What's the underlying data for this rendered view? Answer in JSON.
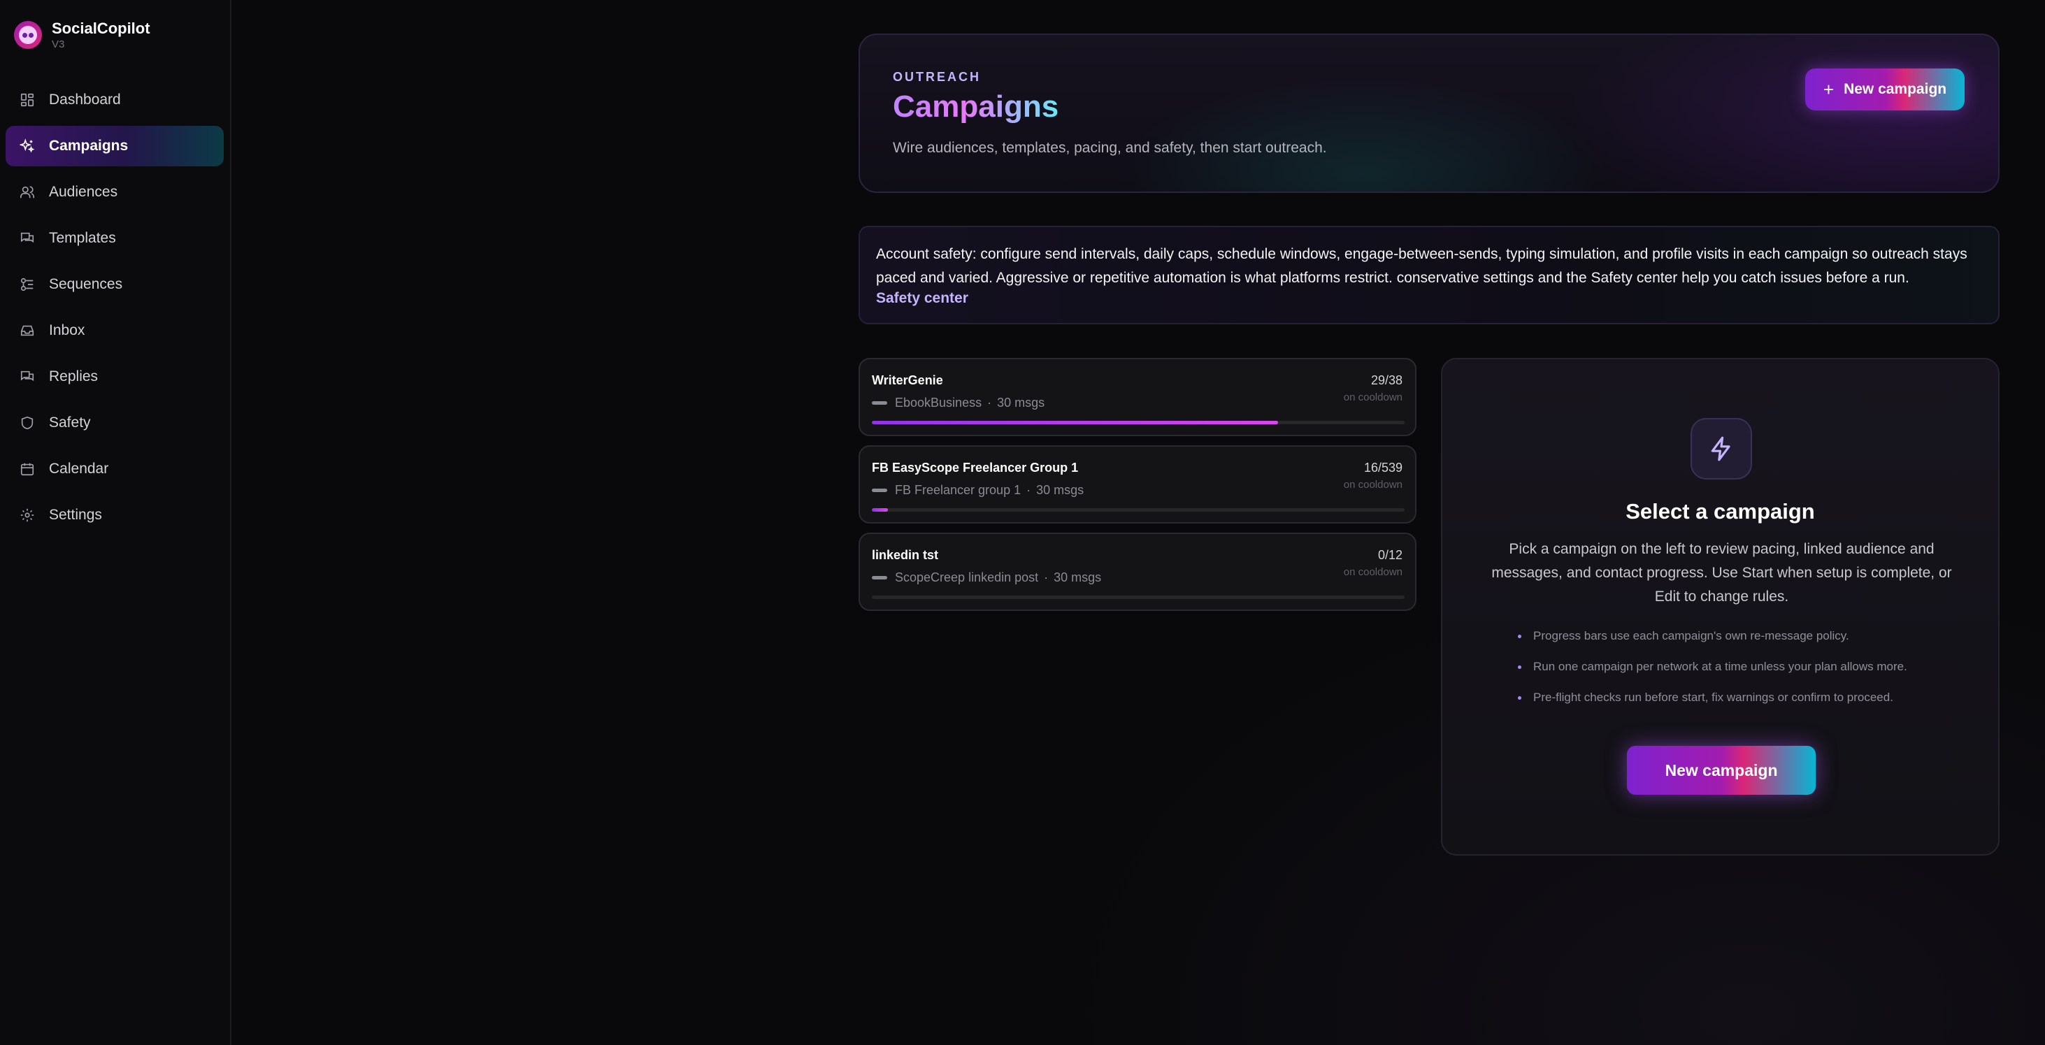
{
  "brand": {
    "name": "SocialCopilot",
    "version": "V3"
  },
  "nav": [
    {
      "label": "Dashboard",
      "icon": "dashboard-icon",
      "active": false
    },
    {
      "label": "Campaigns",
      "icon": "sparkle-icon",
      "active": true
    },
    {
      "label": "Audiences",
      "icon": "users-icon",
      "active": false
    },
    {
      "label": "Templates",
      "icon": "messages-icon",
      "active": false
    },
    {
      "label": "Sequences",
      "icon": "sequences-icon",
      "active": false
    },
    {
      "label": "Inbox",
      "icon": "inbox-icon",
      "active": false
    },
    {
      "label": "Replies",
      "icon": "replies-icon",
      "active": false
    },
    {
      "label": "Safety",
      "icon": "shield-icon",
      "active": false
    },
    {
      "label": "Calendar",
      "icon": "calendar-icon",
      "active": false
    },
    {
      "label": "Settings",
      "icon": "gear-icon",
      "active": false
    }
  ],
  "hero": {
    "eyebrow": "OUTREACH",
    "title": "Campaigns",
    "subtitle": "Wire audiences, templates, pacing, and safety, then start outreach.",
    "button_icon": "+",
    "button_label": "New campaign"
  },
  "alert": {
    "text": "Account safety: configure send intervals, daily caps, schedule windows, engage-between-sends, typing simulation, and profile visits in each campaign so outreach stays paced and varied. Aggressive or repetitive automation is what platforms restrict. conservative settings and the Safety center help you catch issues before a run.",
    "link": "Safety center"
  },
  "campaigns": [
    {
      "name": "WriterGenie",
      "audience": "EbookBusiness",
      "msgs": "30 msgs",
      "count": "29/38",
      "status": "on cooldown",
      "progress": 0.763
    },
    {
      "name": "FB EasyScope Freelancer Group 1",
      "audience": "FB Freelancer group 1",
      "msgs": "30 msgs",
      "count": "16/539",
      "status": "on cooldown",
      "progress": 0.03
    },
    {
      "name": "linkedin tst",
      "audience": "ScopeCreep linkedin post",
      "msgs": "30 msgs",
      "count": "0/12",
      "status": "on cooldown",
      "progress": 0
    }
  ],
  "separator": "·",
  "panel": {
    "icon": "lightning-icon",
    "title": "Select a campaign",
    "description": "Pick a campaign on the left to review pacing, linked audience and messages, and contact progress. Use Start when setup is complete, or Edit to change rules.",
    "tips": [
      "Progress bars use each campaign's own re-message policy.",
      "Run one campaign per network at a time unless your plan allows more.",
      "Pre-flight checks run before start, fix warnings or confirm to proceed."
    ],
    "button_label": "New campaign"
  },
  "colors": {
    "accent_purple": "#9333ea",
    "accent_pink": "#db2777",
    "accent_cyan": "#06b6d4",
    "background": "#09090b"
  }
}
